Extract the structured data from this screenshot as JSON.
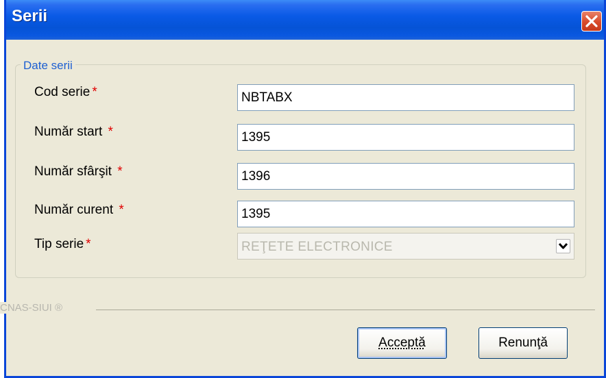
{
  "window": {
    "title": "Serii",
    "close_icon": "close-icon"
  },
  "group": {
    "legend": "Date serii"
  },
  "fields": {
    "cod_serie": {
      "label": "Cod serie",
      "value": "NBTABX"
    },
    "numar_start": {
      "label": "Număr start",
      "value": "1395"
    },
    "numar_sfarsit": {
      "label": "Număr sfârşit",
      "value": "1396"
    },
    "numar_curent": {
      "label": "Număr curent",
      "value": "1395"
    },
    "tip_serie": {
      "label": "Tip serie",
      "value": "REŢETE ELECTRONICE",
      "disabled": true
    }
  },
  "required_marker": "*",
  "footer": {
    "brand": "CNAS-SIUI ®"
  },
  "buttons": {
    "accept": "Acceptă",
    "cancel": "Renunţă"
  },
  "colors": {
    "title_bar": "#0553d6",
    "dialog_bg": "#ece9d8",
    "legend": "#1d5fd1",
    "required": "#e00000",
    "close_button": "#d84a2a"
  }
}
